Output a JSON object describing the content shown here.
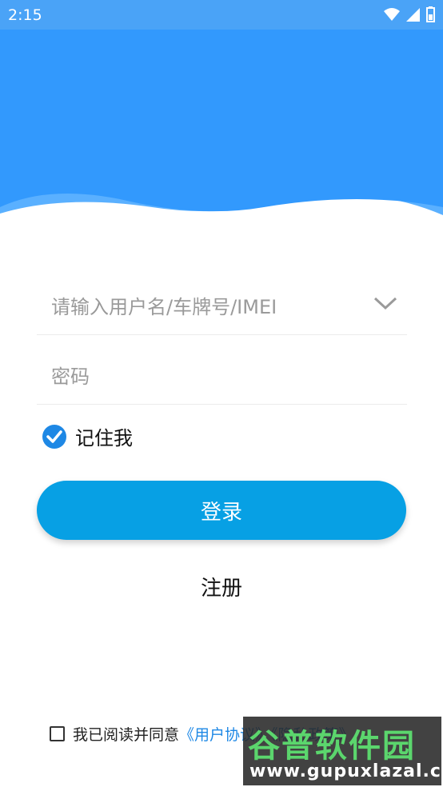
{
  "status_bar": {
    "time": "2:15",
    "icons": [
      "wifi-icon",
      "signal-icon",
      "battery-icon"
    ]
  },
  "colors": {
    "header_blue": "#3299fd",
    "wave_light": "#5ab0ff",
    "button_blue": "#07a0e4",
    "link_blue": "#1e88e5"
  },
  "login_form": {
    "username_placeholder": "请输入用户名/车牌号/IMEI",
    "password_placeholder": "密码",
    "remember_label": "记住我",
    "remember_checked": true,
    "login_button": "登录",
    "register_link": "注册"
  },
  "agreement": {
    "checked": false,
    "prefix": "我已阅读并同意",
    "link_text": "《用户协议》《隐私政策》"
  },
  "watermark": {
    "title": "谷普软件园",
    "url": "www.gupuxlazal.com"
  }
}
